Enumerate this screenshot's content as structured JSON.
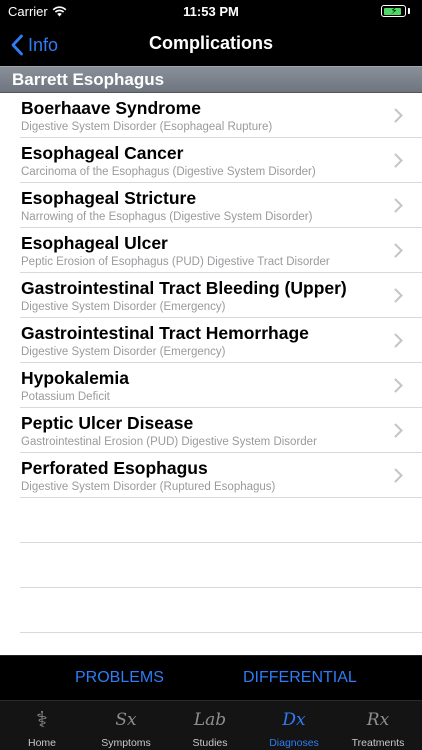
{
  "status_bar": {
    "carrier": "Carrier",
    "time": "11:53 PM",
    "battery_color": "#4cd964"
  },
  "nav": {
    "back_label": "Info",
    "title": "Complications"
  },
  "section": {
    "title": "Barrett Esophagus"
  },
  "items": [
    {
      "title": "Boerhaave Syndrome",
      "subtitle": "Digestive System Disorder (Esophageal Rupture)"
    },
    {
      "title": "Esophageal Cancer",
      "subtitle": "Carcinoma of the Esophagus (Digestive System Disorder)"
    },
    {
      "title": "Esophageal Stricture",
      "subtitle": "Narrowing of the Esophagus (Digestive System Disorder)"
    },
    {
      "title": "Esophageal Ulcer",
      "subtitle": "Peptic Erosion of Esophagus (PUD) Digestive Tract Disorder"
    },
    {
      "title": "Gastrointestinal Tract Bleeding (Upper)",
      "subtitle": "Digestive System Disorder (Emergency)"
    },
    {
      "title": "Gastrointestinal Tract Hemorrhage",
      "subtitle": "Digestive System Disorder (Emergency)"
    },
    {
      "title": "Hypokalemia",
      "subtitle": "Potassium Deficit"
    },
    {
      "title": "Peptic Ulcer Disease",
      "subtitle": "Gastrointestinal Erosion (PUD) Digestive System Disorder"
    },
    {
      "title": "Perforated Esophagus",
      "subtitle": "Digestive System Disorder (Ruptured Esophagus)"
    }
  ],
  "segments": {
    "problems": "PROBLEMS",
    "differential": "DIFFERENTIAL"
  },
  "tabs": [
    {
      "label": "Home",
      "icon": "caduceus-icon",
      "glyph": "⚕",
      "active": false
    },
    {
      "label": "Symptoms",
      "icon": "sx-icon",
      "glyph": "Sx",
      "active": false
    },
    {
      "label": "Studies",
      "icon": "lab-icon",
      "glyph": "Lab",
      "active": false
    },
    {
      "label": "Diagnoses",
      "icon": "dx-icon",
      "glyph": "Dx",
      "active": true
    },
    {
      "label": "Treatments",
      "icon": "rx-icon",
      "glyph": "Rx",
      "active": false
    }
  ],
  "accent_color": "#2f7cf6"
}
